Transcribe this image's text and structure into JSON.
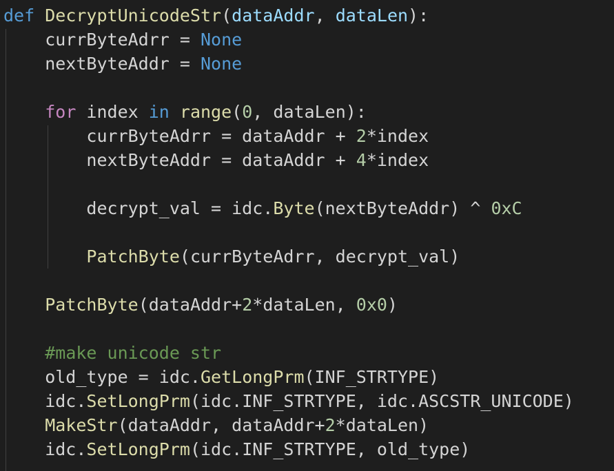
{
  "colors": {
    "background": "#1e1e1e",
    "keyword": "#569cd6",
    "control_keyword": "#c586c0",
    "function": "#dcdcaa",
    "parameter": "#9cdcfe",
    "number": "#b5cea8",
    "comment": "#6a9955",
    "default_text": "#d4d4d4",
    "indent_guide": "#404040"
  },
  "lines": [
    {
      "tokens": [
        {
          "t": "def",
          "c": "kw"
        },
        {
          "t": " ",
          "c": "plain"
        },
        {
          "t": "DecryptUnicodeStr",
          "c": "fn"
        },
        {
          "t": "(",
          "c": "plain"
        },
        {
          "t": "dataAddr",
          "c": "param"
        },
        {
          "t": ", ",
          "c": "plain"
        },
        {
          "t": "dataLen",
          "c": "param"
        },
        {
          "t": "):",
          "c": "plain"
        }
      ]
    },
    {
      "tokens": [
        {
          "t": "    currByteAdrr = ",
          "c": "plain"
        },
        {
          "t": "None",
          "c": "kw"
        }
      ]
    },
    {
      "tokens": [
        {
          "t": "    nextByteAddr = ",
          "c": "plain"
        },
        {
          "t": "None",
          "c": "kw"
        }
      ]
    },
    {
      "tokens": []
    },
    {
      "tokens": [
        {
          "t": "    ",
          "c": "plain"
        },
        {
          "t": "for",
          "c": "ctrl"
        },
        {
          "t": " index ",
          "c": "plain"
        },
        {
          "t": "in",
          "c": "kw"
        },
        {
          "t": " ",
          "c": "plain"
        },
        {
          "t": "range",
          "c": "fn"
        },
        {
          "t": "(",
          "c": "plain"
        },
        {
          "t": "0",
          "c": "num"
        },
        {
          "t": ", dataLen):",
          "c": "plain"
        }
      ]
    },
    {
      "tokens": [
        {
          "t": "        currByteAdrr = dataAddr + ",
          "c": "plain"
        },
        {
          "t": "2",
          "c": "num"
        },
        {
          "t": "*index",
          "c": "plain"
        }
      ]
    },
    {
      "tokens": [
        {
          "t": "        nextByteAddr = dataAddr + ",
          "c": "plain"
        },
        {
          "t": "4",
          "c": "num"
        },
        {
          "t": "*index",
          "c": "plain"
        }
      ]
    },
    {
      "tokens": []
    },
    {
      "tokens": [
        {
          "t": "        decrypt_val = idc.",
          "c": "plain"
        },
        {
          "t": "Byte",
          "c": "fn"
        },
        {
          "t": "(nextByteAddr) ^ ",
          "c": "plain"
        },
        {
          "t": "0xC",
          "c": "num"
        }
      ]
    },
    {
      "tokens": []
    },
    {
      "tokens": [
        {
          "t": "        ",
          "c": "plain"
        },
        {
          "t": "PatchByte",
          "c": "fn"
        },
        {
          "t": "(currByteAdrr, decrypt_val)",
          "c": "plain"
        }
      ]
    },
    {
      "tokens": []
    },
    {
      "tokens": [
        {
          "t": "    ",
          "c": "plain"
        },
        {
          "t": "PatchByte",
          "c": "fn"
        },
        {
          "t": "(dataAddr+",
          "c": "plain"
        },
        {
          "t": "2",
          "c": "num"
        },
        {
          "t": "*dataLen, ",
          "c": "plain"
        },
        {
          "t": "0x0",
          "c": "num"
        },
        {
          "t": ")",
          "c": "plain"
        }
      ]
    },
    {
      "tokens": []
    },
    {
      "tokens": [
        {
          "t": "    ",
          "c": "plain"
        },
        {
          "t": "#make unicode str",
          "c": "cmt"
        }
      ]
    },
    {
      "tokens": [
        {
          "t": "    old_type = idc.",
          "c": "plain"
        },
        {
          "t": "GetLongPrm",
          "c": "fn"
        },
        {
          "t": "(INF_STRTYPE)",
          "c": "plain"
        }
      ]
    },
    {
      "tokens": [
        {
          "t": "    idc.",
          "c": "plain"
        },
        {
          "t": "SetLongPrm",
          "c": "fn"
        },
        {
          "t": "(idc.INF_STRTYPE, idc.ASCSTR_UNICODE)",
          "c": "plain"
        }
      ]
    },
    {
      "tokens": [
        {
          "t": "    ",
          "c": "plain"
        },
        {
          "t": "MakeStr",
          "c": "fn"
        },
        {
          "t": "(dataAddr, dataAddr+",
          "c": "plain"
        },
        {
          "t": "2",
          "c": "num"
        },
        {
          "t": "*dataLen)",
          "c": "plain"
        }
      ]
    },
    {
      "tokens": [
        {
          "t": "    idc.",
          "c": "plain"
        },
        {
          "t": "SetLongPrm",
          "c": "fn"
        },
        {
          "t": "(idc.INF_STRTYPE, old_type)",
          "c": "plain"
        }
      ]
    }
  ]
}
